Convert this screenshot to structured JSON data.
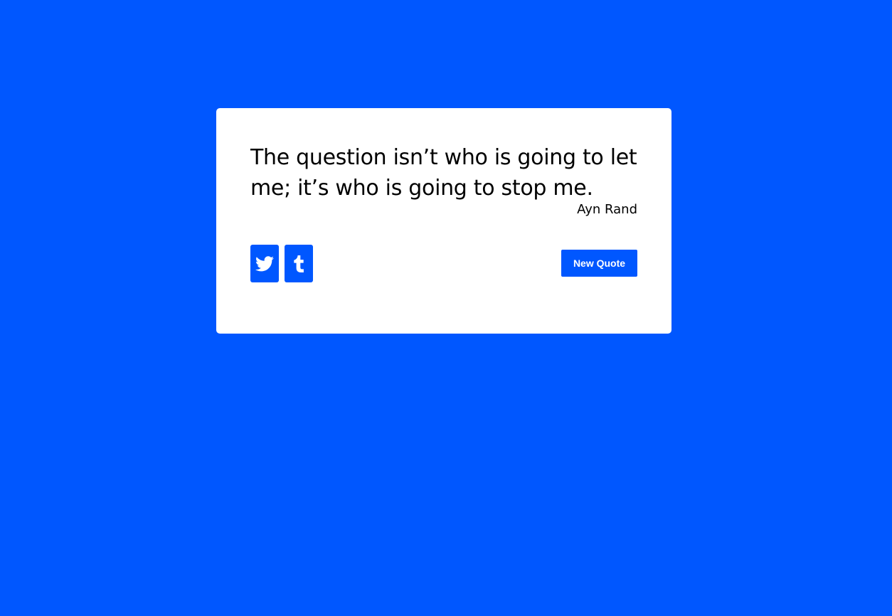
{
  "quote": {
    "text": "The question isn’t who is going to let me; it’s who is going to stop me.",
    "author": "Ayn Rand"
  },
  "actions": {
    "twitter_icon": "twitter-icon",
    "tumblr_icon": "tumblr-icon",
    "new_quote_label": "New Quote"
  },
  "colors": {
    "background": "#0057ff",
    "card": "#ffffff",
    "accent": "#0057ff",
    "text": "#000000"
  }
}
